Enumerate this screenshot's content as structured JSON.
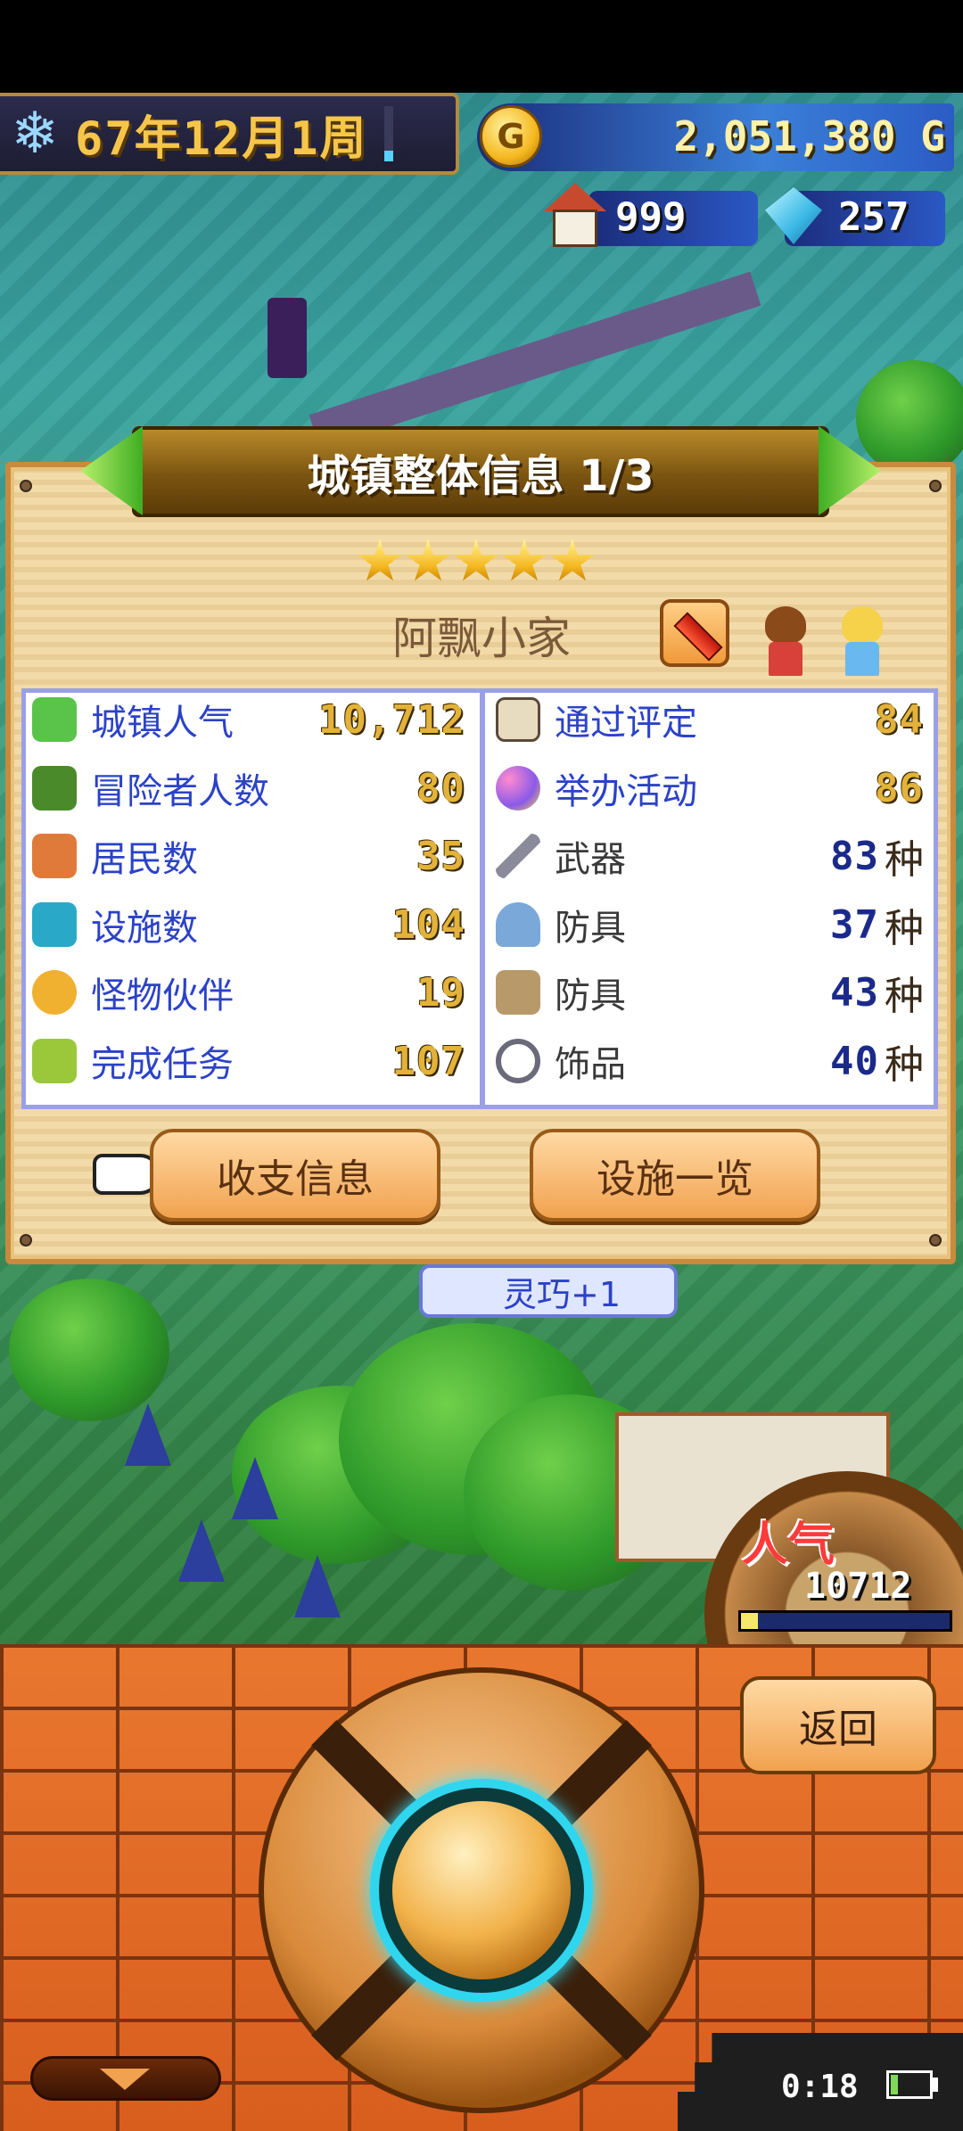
{
  "hud": {
    "date": "67年12月1周",
    "gold": "2,051,380 G",
    "gold_coin_label": "G",
    "houses": "999",
    "gems": "257"
  },
  "dialog": {
    "title": "城镇整体信息 1/3",
    "rating_stars": 5,
    "town_name": "阿飘小家",
    "stats_left": [
      {
        "label": "城镇人气",
        "value": "10,712",
        "icon": "cactus-icon"
      },
      {
        "label": "冒险者人数",
        "value": "80",
        "icon": "adventurer-icon"
      },
      {
        "label": "居民数",
        "value": "35",
        "icon": "house-icon"
      },
      {
        "label": "设施数",
        "value": "104",
        "icon": "facility-icon"
      },
      {
        "label": "怪物伙伴",
        "value": "19",
        "icon": "monster-icon"
      },
      {
        "label": "完成任务",
        "value": "107",
        "icon": "quest-icon"
      }
    ],
    "stats_right": [
      {
        "label": "通过评定",
        "value": "84",
        "unit": "",
        "icon": "certificate-icon"
      },
      {
        "label": "举办活动",
        "value": "86",
        "unit": "",
        "icon": "balloon-icon"
      },
      {
        "label": "武器",
        "value": "83",
        "unit": "种",
        "icon": "sword-icon"
      },
      {
        "label": "防具",
        "value": "37",
        "unit": "种",
        "icon": "helmet-icon"
      },
      {
        "label": "防具",
        "value": "43",
        "unit": "种",
        "icon": "armor-icon"
      },
      {
        "label": "饰品",
        "value": "40",
        "unit": "种",
        "icon": "ring-icon"
      }
    ],
    "buttons": {
      "income": "收支信息",
      "facilities": "设施一览"
    }
  },
  "scene": {
    "bubble_text": "灵巧+1",
    "popularity_label": "人气",
    "popularity_value": "10712",
    "popularity_fill_fraction": 0.08
  },
  "controls": {
    "back": "返回"
  },
  "status": {
    "clock": "0:18",
    "battery_fraction": 0.2
  },
  "colors": {
    "stat_label": "#2b42c8",
    "stat_value_gold": "#e3b23a",
    "stat_value_navy": "#1b2a8a",
    "panel_wood": "#f1d8a2",
    "brick": "#e9772e"
  }
}
